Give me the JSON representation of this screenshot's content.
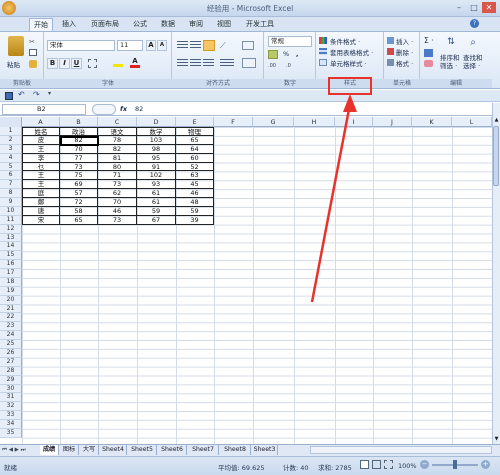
{
  "window": {
    "title": "经验用 - Microsoft Excel",
    "minimize": "–",
    "maximize": "□",
    "close": "✕"
  },
  "tabs": [
    "开始",
    "插入",
    "页面布局",
    "公式",
    "数据",
    "审阅",
    "视图",
    "开发工具"
  ],
  "ribbon": {
    "clipboard": {
      "paste": "粘贴",
      "label": "剪贴板"
    },
    "font": {
      "name": "宋体",
      "size": "11",
      "bold": "B",
      "italic": "I",
      "underline": "U",
      "grow": "A",
      "shrink": "A",
      "color_a": "A",
      "label": "字体"
    },
    "alignment": {
      "label": "对齐方式"
    },
    "number": {
      "format": "常规",
      "percent": "%",
      "comma": ",",
      "label": "数字"
    },
    "styles": {
      "conditional": "条件格式 ·",
      "table": "套用表格格式 ·",
      "cell": "单元格样式 ·",
      "label": "样式"
    },
    "cells": {
      "insert": "插入 ·",
      "delete": "删除 ·",
      "format": "格式 ·",
      "label": "单元格"
    },
    "editing": {
      "sum": "Σ ·",
      "sort": "排序和\n筛选 ·",
      "find": "查找和\n选择 ·",
      "label": "编辑"
    }
  },
  "formula_bar": {
    "name_box": "B2",
    "fx": "fx",
    "value": "82"
  },
  "columns": [
    "A",
    "B",
    "C",
    "D",
    "E",
    "F",
    "G",
    "H",
    "I",
    "J",
    "K",
    "L"
  ],
  "rows": [
    "1",
    "2",
    "3",
    "4",
    "5",
    "6",
    "7",
    "8",
    "9",
    "10",
    "11",
    "12",
    "13",
    "14",
    "15",
    "16",
    "17",
    "18",
    "19",
    "20",
    "21",
    "22",
    "23",
    "24",
    "25",
    "26",
    "27",
    "28",
    "29",
    "30",
    "31",
    "32",
    "33",
    "34",
    "35"
  ],
  "table": {
    "header": [
      "姓名",
      "政治",
      "语文",
      "数学",
      "物理"
    ],
    "rows": [
      [
        "皮",
        "82",
        "78",
        "103",
        "65"
      ],
      [
        "王",
        "70",
        "82",
        "98",
        "64"
      ],
      [
        "李",
        "77",
        "81",
        "95",
        "60"
      ],
      [
        "乜",
        "73",
        "80",
        "91",
        "52"
      ],
      [
        "王",
        "75",
        "71",
        "102",
        "63"
      ],
      [
        "王",
        "69",
        "73",
        "93",
        "45"
      ],
      [
        "庭",
        "57",
        "62",
        "61",
        "46"
      ],
      [
        "鄭",
        "72",
        "70",
        "61",
        "48"
      ],
      [
        "唐",
        "58",
        "46",
        "59",
        "59"
      ],
      [
        "宋",
        "65",
        "73",
        "67",
        "39"
      ]
    ]
  },
  "sheet_tabs": [
    "成绩",
    "图标",
    "大写",
    "Sheet4",
    "Sheet5",
    "Sheet6",
    "Sheet7",
    "Sheet8",
    "Sheet3"
  ],
  "status": {
    "mode": "就绪",
    "average": "平均值: 69.625",
    "count": "计数: 40",
    "sum": "求和: 2785",
    "zoom": "100%"
  }
}
